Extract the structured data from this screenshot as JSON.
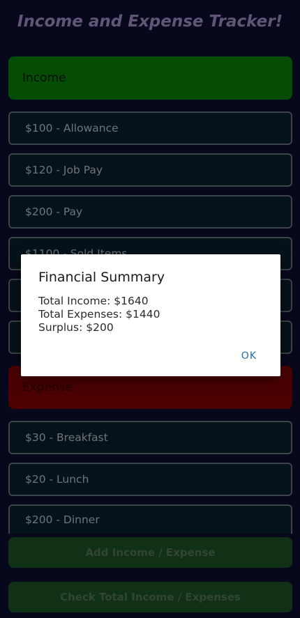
{
  "app": {
    "title": "Income and Expense Tracker!"
  },
  "income": {
    "header": "Income",
    "entries": [
      "$100 - Allowance",
      "$120 - Job Pay",
      "$200 - Pay",
      "$1100 - Sold Items",
      "",
      ""
    ]
  },
  "expense": {
    "header": "Expense",
    "entries": [
      "$30 - Breakfast",
      "$20 - Lunch",
      "$200 - Dinner"
    ]
  },
  "buttons": {
    "add": "Add Income / Expense",
    "check": "Check Total Income / Expenses"
  },
  "dialog": {
    "title": "Financial Summary",
    "total_income": "Total Income: $1640",
    "total_expenses": "Total Expenses: $1440",
    "surplus": "Surplus: $200",
    "ok": "OK"
  },
  "colors": {
    "income_header": "#0a8a0a",
    "expense_header": "#8b0000",
    "button": "#1f5a2a",
    "title": "#b39ddb"
  }
}
